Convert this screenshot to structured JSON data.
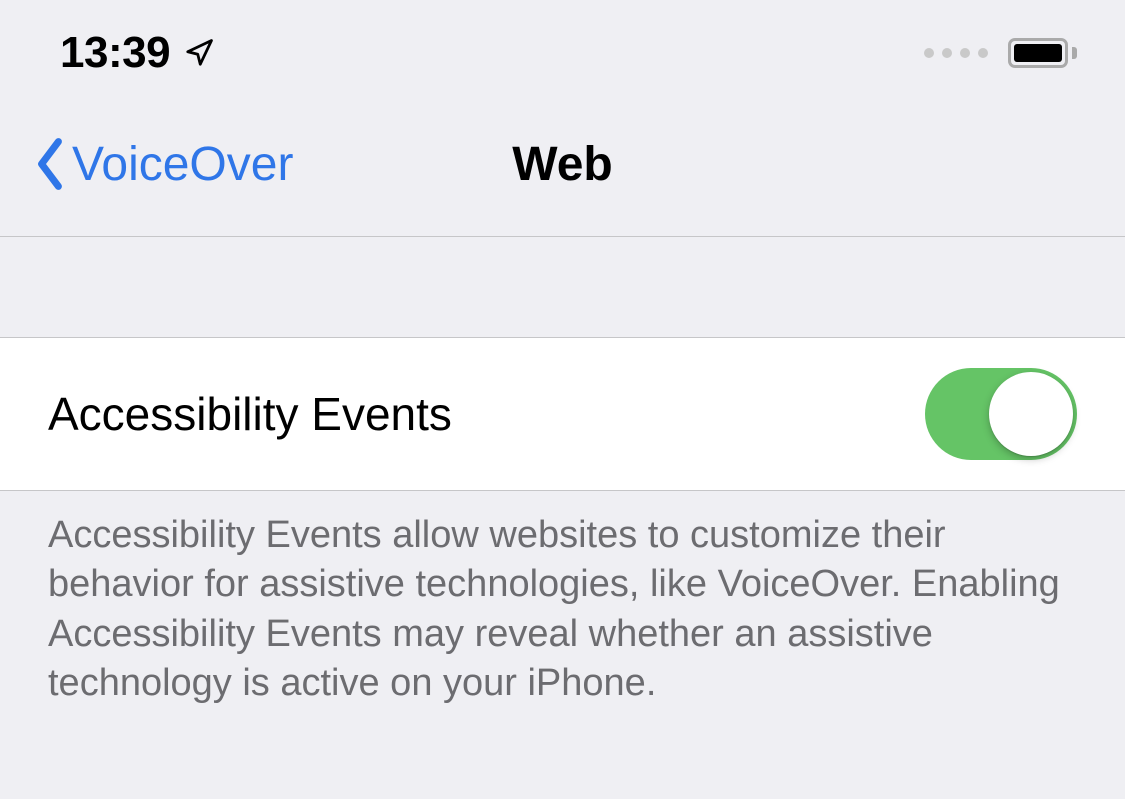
{
  "status_bar": {
    "time": "13:39"
  },
  "nav": {
    "back_label": "VoiceOver",
    "title": "Web"
  },
  "setting": {
    "label": "Accessibility Events",
    "enabled": true
  },
  "description": "Accessibility Events allow websites to customize their behavior for assistive technologies, like VoiceOver. Enabling Accessibility Events may reveal whether an assistive technology is active on your iPhone."
}
